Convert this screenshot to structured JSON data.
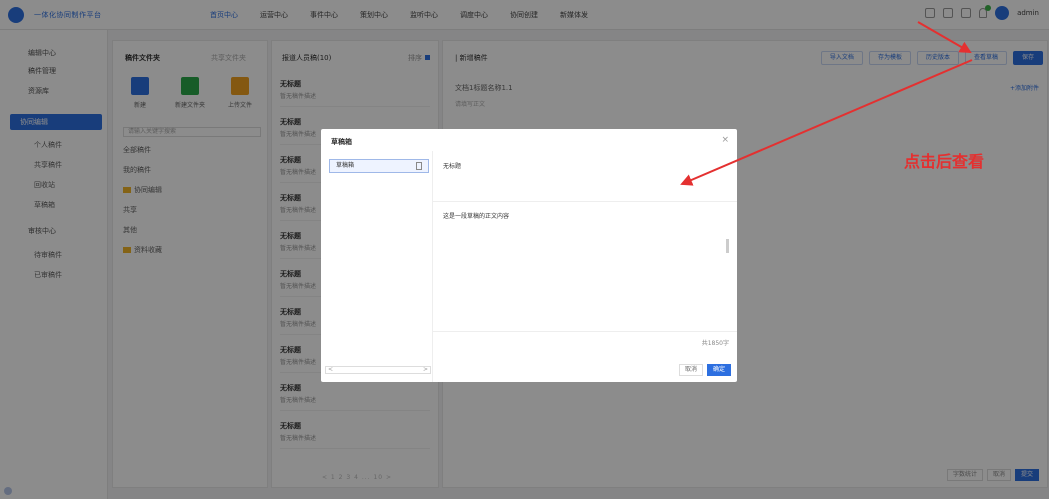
{
  "header": {
    "app_title": "一体化协同制作平台",
    "nav": [
      "首页中心",
      "运营中心",
      "事件中心",
      "策划中心",
      "监听中心",
      "调度中心",
      "协同创建",
      "新媒体发"
    ],
    "active_index": 0,
    "user": "admin"
  },
  "sidebar": {
    "items": [
      {
        "label": "编辑中心",
        "level": "top"
      },
      {
        "label": "稿件管理",
        "level": "top"
      },
      {
        "label": "资源库",
        "level": "top"
      },
      {
        "label": "协同编辑",
        "level": "top",
        "active": true
      },
      {
        "label": "个人稿件",
        "level": "sub"
      },
      {
        "label": "共享稿件",
        "level": "sub"
      },
      {
        "label": "回收站",
        "level": "sub"
      },
      {
        "label": "草稿箱",
        "level": "sub"
      },
      {
        "label": "审核中心",
        "level": "top"
      },
      {
        "label": "待审稿件",
        "level": "sub"
      },
      {
        "label": "已审稿件",
        "level": "sub"
      }
    ]
  },
  "panel_folders": {
    "tab_active": "稿件文件夹",
    "tab_inactive": "共享文件夹",
    "quick_actions": [
      {
        "label": "新建",
        "color": "#2d6fe0"
      },
      {
        "label": "新建文件夹",
        "color": "#2aa84a"
      },
      {
        "label": "上传文件",
        "color": "#f0a020"
      }
    ],
    "search_placeholder": "请输入关键字搜索",
    "tree": [
      {
        "label": "全部稿件",
        "folder": false
      },
      {
        "label": "我的稿件",
        "folder": false
      },
      {
        "label": "协同编辑",
        "folder": true
      },
      {
        "label": "共享",
        "folder": false
      },
      {
        "label": "其他",
        "folder": false
      },
      {
        "label": "资料收藏",
        "folder": true
      }
    ]
  },
  "panel_docs": {
    "title": "报道人员稿(10)",
    "sort_label": "排序",
    "docs": [
      {
        "title": "无标题",
        "sub": "暂无稿件描述"
      },
      {
        "title": "无标题",
        "sub": "暂无稿件描述"
      },
      {
        "title": "无标题",
        "sub": "暂无稿件描述"
      },
      {
        "title": "无标题",
        "sub": "暂无稿件描述"
      },
      {
        "title": "无标题",
        "sub": "暂无稿件描述"
      },
      {
        "title": "无标题",
        "sub": "暂无稿件描述"
      },
      {
        "title": "无标题",
        "sub": "暂无稿件描述"
      },
      {
        "title": "无标题",
        "sub": "暂无稿件描述"
      },
      {
        "title": "无标题",
        "sub": "暂无稿件描述"
      },
      {
        "title": "无标题",
        "sub": "暂无稿件描述"
      }
    ],
    "pager": "< 1 2 3 4 ... 10 >"
  },
  "panel_editor": {
    "title": "| 新增稿件",
    "line1": "文档1标题名称1.1",
    "line2": "请填写正文",
    "toolbar": [
      {
        "label": "导入文档",
        "primary": false
      },
      {
        "label": "存为模板",
        "primary": false
      },
      {
        "label": "历史版本",
        "primary": false
      },
      {
        "label": "查看草稿",
        "primary": false
      },
      {
        "label": "保存",
        "primary": true
      }
    ],
    "add_link": "+添加附件",
    "bottom_left": "字数统计",
    "bottom_mid": "取消",
    "bottom_primary": "提交"
  },
  "modal": {
    "title": "草稿箱",
    "close": "×",
    "selected_item": "草稿箱",
    "section1": "无标题",
    "section2": "这是一段草稿的正文内容",
    "word_count": "共1850字",
    "cancel": "取消",
    "confirm": "确定"
  },
  "annotation": {
    "text": "点击后查看",
    "color": "#e43030"
  }
}
